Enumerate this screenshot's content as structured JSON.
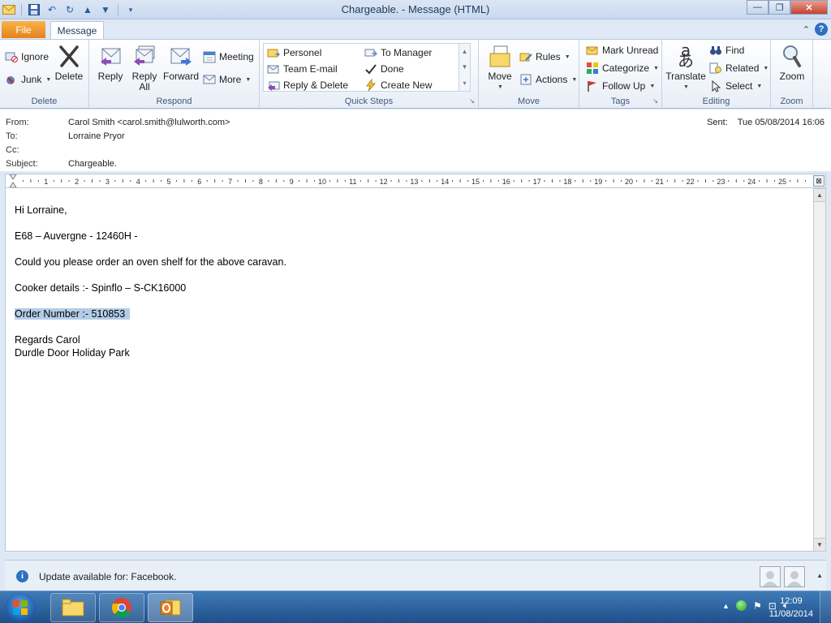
{
  "window": {
    "title": "Chargeable.  -  Message (HTML)"
  },
  "tabs": {
    "file": "File",
    "message": "Message"
  },
  "ribbon": {
    "delete_group": {
      "label": "Delete",
      "ignore": "Ignore",
      "junk": "Junk",
      "delete": "Delete"
    },
    "respond_group": {
      "label": "Respond",
      "reply": "Reply",
      "reply_all_1": "Reply",
      "reply_all_2": "All",
      "forward": "Forward",
      "meeting": "Meeting",
      "more": "More"
    },
    "quick_steps_group": {
      "label": "Quick Steps",
      "items": [
        "Personel",
        "To Manager",
        "Team E-mail",
        "Done",
        "Reply & Delete",
        "Create New"
      ]
    },
    "move_group": {
      "label": "Move",
      "move": "Move",
      "rules": "Rules",
      "actions": "Actions"
    },
    "tags_group": {
      "label": "Tags",
      "mark_unread": "Mark Unread",
      "categorize": "Categorize",
      "follow_up": "Follow Up"
    },
    "editing_group": {
      "label": "Editing",
      "translate": "Translate",
      "find": "Find",
      "related": "Related",
      "select": "Select"
    },
    "zoom_group": {
      "label": "Zoom",
      "zoom": "Zoom"
    }
  },
  "message": {
    "from_label": "From:",
    "from_value": "Carol Smith <carol.smith@lulworth.com>",
    "to_label": "To:",
    "to_value": "Lorraine Pryor",
    "cc_label": "Cc:",
    "subject_label": "Subject:",
    "subject_value": "Chargeable.",
    "sent_label": "Sent:",
    "sent_value": "Tue 05/08/2014 16:06",
    "body": [
      "Hi Lorraine,",
      "E68 – Auvergne -  12460H  -",
      "Could you please order an oven shelf for the above caravan.",
      "Cooker details  :-  Spinflo – S-CK16000",
      "Order Number :-  510853",
      "Regards Carol",
      "Durdle Door Holiday Park"
    ]
  },
  "ruler": {
    "numbers": [
      "1",
      "2",
      "3",
      "4",
      "5",
      "6",
      "7",
      "8",
      "9",
      "10",
      "11",
      "12",
      "13",
      "14",
      "15",
      "16",
      "17",
      "18",
      "19",
      "20",
      "21",
      "22",
      "23",
      "24",
      "25"
    ]
  },
  "infobar": {
    "text": "Update available for: Facebook."
  },
  "taskbar": {
    "time": "12:09",
    "date": "11/08/2014"
  }
}
